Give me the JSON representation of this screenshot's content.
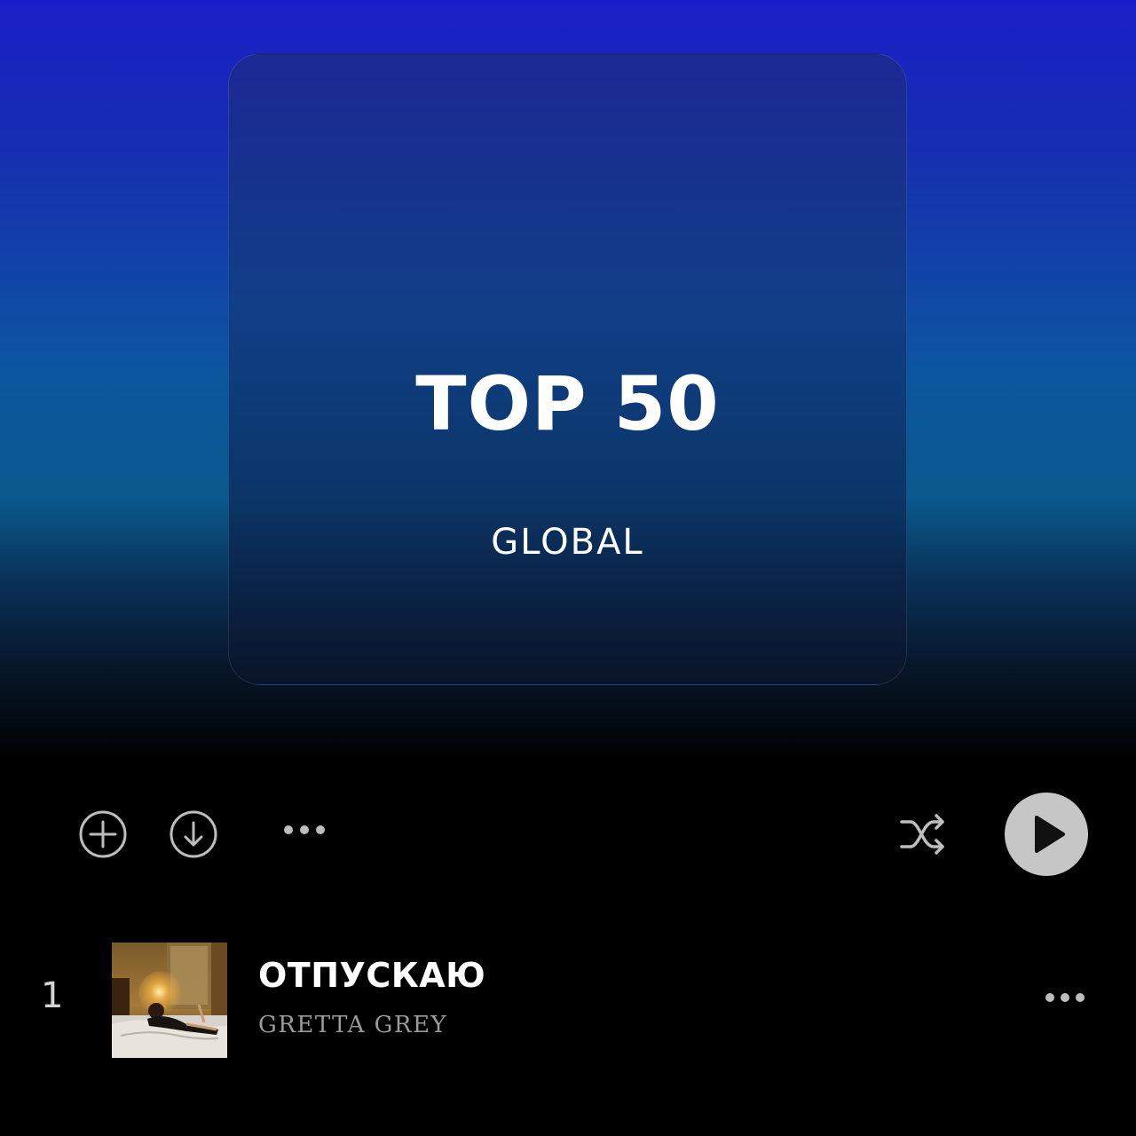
{
  "cover": {
    "title": "TOP 50",
    "subtitle": "GLOBAL"
  },
  "toolbar": {
    "icons": [
      "plus-circle-icon",
      "download-circle-icon",
      "more-horizontal-icon",
      "shuffle-icon",
      "play-icon"
    ]
  },
  "tracks": [
    {
      "number": "1",
      "title": "ОТПУСКАЮ",
      "artist": "GRETTA GREY",
      "thumbnail": "album-cover-image"
    }
  ],
  "colors": {
    "gradient_top": "#1a1ec8",
    "gradient_mid": "#0a5a8e",
    "background": "#000000",
    "icon_gray": "#b8b8b8",
    "play_button": "#c4c4c4"
  }
}
